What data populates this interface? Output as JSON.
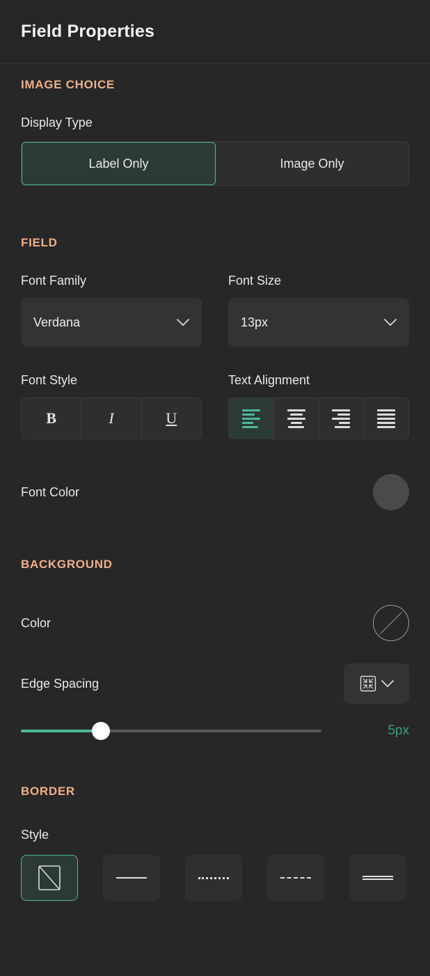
{
  "header": {
    "title": "Field Properties"
  },
  "sections": {
    "image_choice": {
      "title": "IMAGE CHOICE",
      "display_type": {
        "label": "Display Type",
        "options": [
          "Label Only",
          "Image Only"
        ],
        "selected": "Label Only"
      }
    },
    "field": {
      "title": "FIELD",
      "font_family": {
        "label": "Font Family",
        "value": "Verdana"
      },
      "font_size": {
        "label": "Font Size",
        "value": "13px"
      },
      "font_style": {
        "label": "Font Style",
        "options": [
          "B",
          "I",
          "U"
        ],
        "selected": ""
      },
      "text_alignment": {
        "label": "Text Alignment",
        "options": [
          "align-left",
          "align-center",
          "align-right",
          "align-justify"
        ],
        "selected": "align-left"
      },
      "font_color": {
        "label": "Font Color",
        "value": "#4a4a4a",
        "swatch": "solid"
      }
    },
    "background": {
      "title": "BACKGROUND",
      "color": {
        "label": "Color",
        "value": "none",
        "swatch": "transparent"
      },
      "edge_spacing": {
        "label": "Edge Spacing",
        "mode_icon": "collapse-all-sides-icon",
        "value": "5px",
        "slider_percent": 25
      }
    },
    "border": {
      "title": "BORDER",
      "style": {
        "label": "Style",
        "options": [
          "none",
          "solid",
          "dotted",
          "dashed",
          "double"
        ],
        "selected": "none"
      }
    }
  },
  "colors": {
    "panel_bg": "#272727",
    "header_bg": "#262626",
    "section_heading": "#efb088",
    "accent_green": "#4fb79b",
    "value_green": "#3f9d77",
    "control_bg": "#333333",
    "active_bg": "#2b3a35",
    "text": "#e8e8e8"
  }
}
